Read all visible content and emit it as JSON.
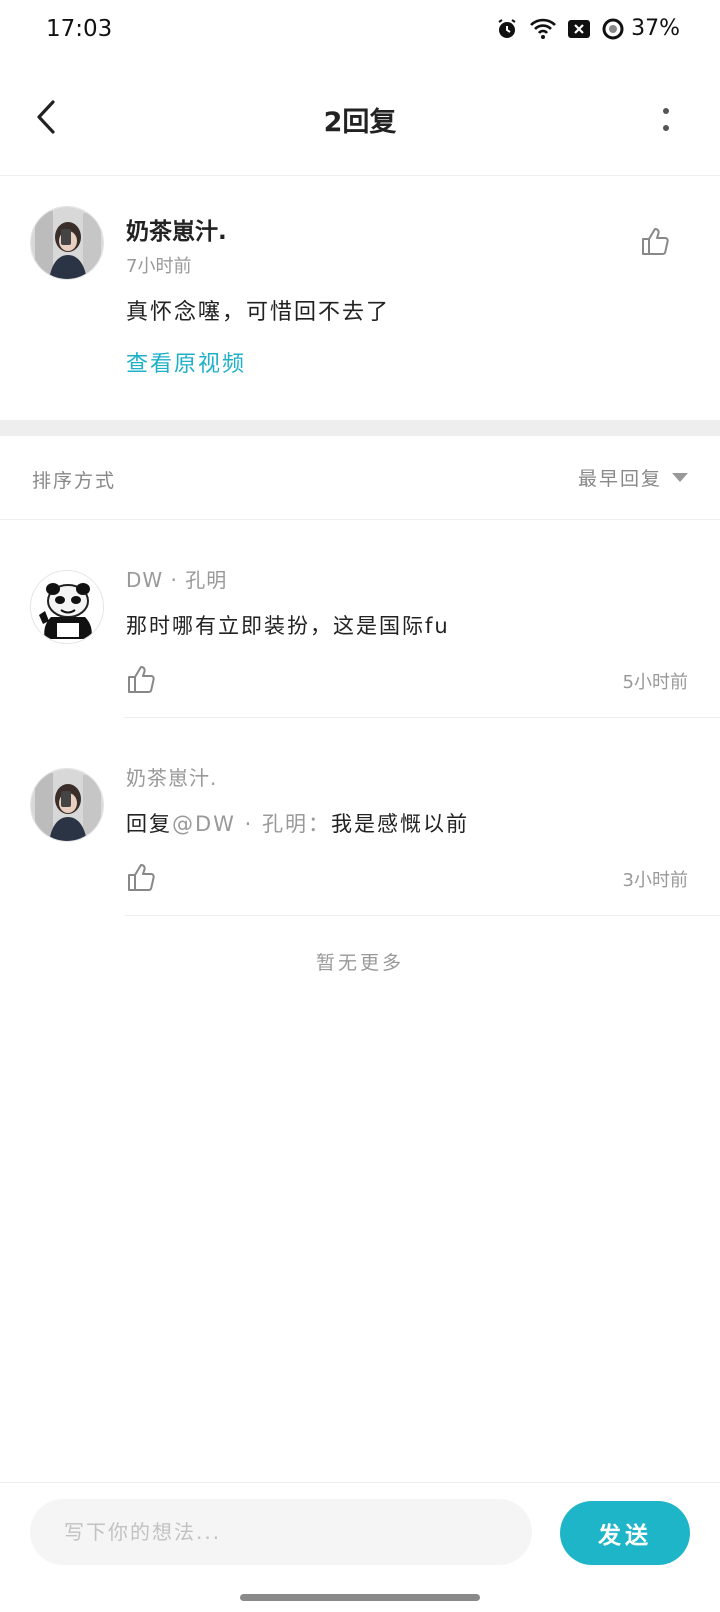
{
  "status_bar": {
    "time": "17:03",
    "battery": "37%",
    "icons": [
      "alarm-icon",
      "wifi-icon",
      "sim-off-icon",
      "battery-saver-icon"
    ]
  },
  "header": {
    "title": "2回复",
    "back_icon": "chevron-left-icon",
    "more_icon": "more-vertical-icon"
  },
  "main_comment": {
    "username": "奶茶崽汁.",
    "time": "7小时前",
    "text": "真怀念噻，可惜回不去了",
    "link": "查看原视频"
  },
  "sort": {
    "label": "排序方式",
    "selected": "最早回复"
  },
  "replies": [
    {
      "username": "DW · 孔明",
      "text": "那时哪有立即装扮，这是国际fu",
      "time": "5小时前"
    },
    {
      "username": "奶茶崽汁.",
      "reply_prefix": "回复",
      "mention": "@DW · 孔明",
      "separator": "：",
      "text": "我是感慨以前",
      "time": "3小时前"
    }
  ],
  "no_more": "暂无更多",
  "composer": {
    "placeholder": "写下你的想法...",
    "send_label": "发送"
  },
  "colors": {
    "accent": "#1fb5c8",
    "link": "#1fb0c9",
    "secondary_text": "#999999",
    "divider": "#eeeeee"
  }
}
